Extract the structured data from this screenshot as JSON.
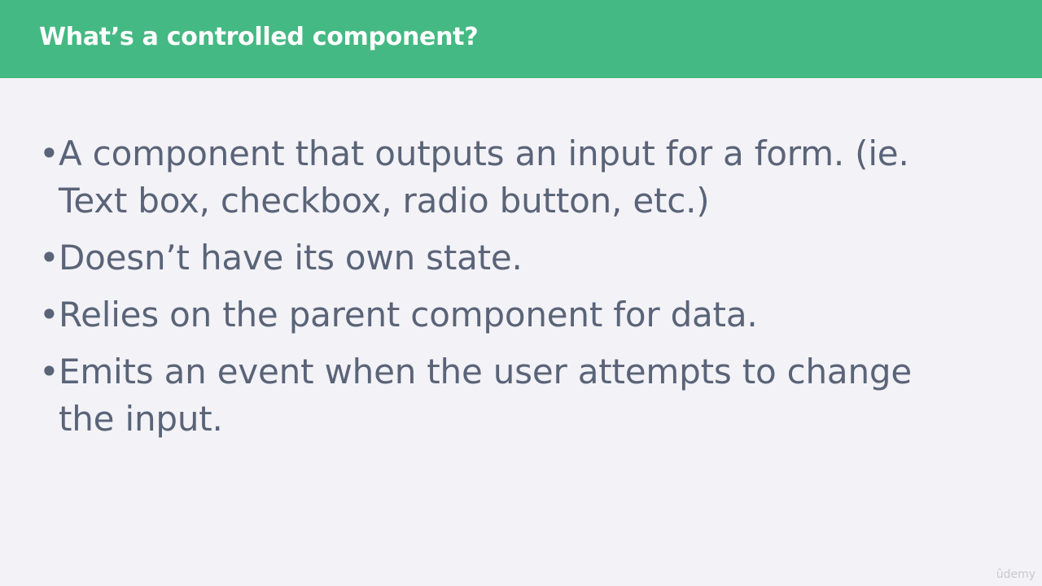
{
  "slide": {
    "title": "What’s a controlled component?",
    "bullet_marker": "•",
    "bullets": [
      "A component that outputs an input for a form. (ie. Text box, checkbox, radio button, etc.)",
      "Doesn’t have its own state.",
      "Relies on the parent component for data.",
      "Emits an event when the user attempts to change the input."
    ],
    "watermark": "ûdemy"
  },
  "colors": {
    "header_background": "#45b983",
    "slide_background": "#f3f2f7",
    "title_text": "#ffffff",
    "body_text": "#5a6478"
  }
}
